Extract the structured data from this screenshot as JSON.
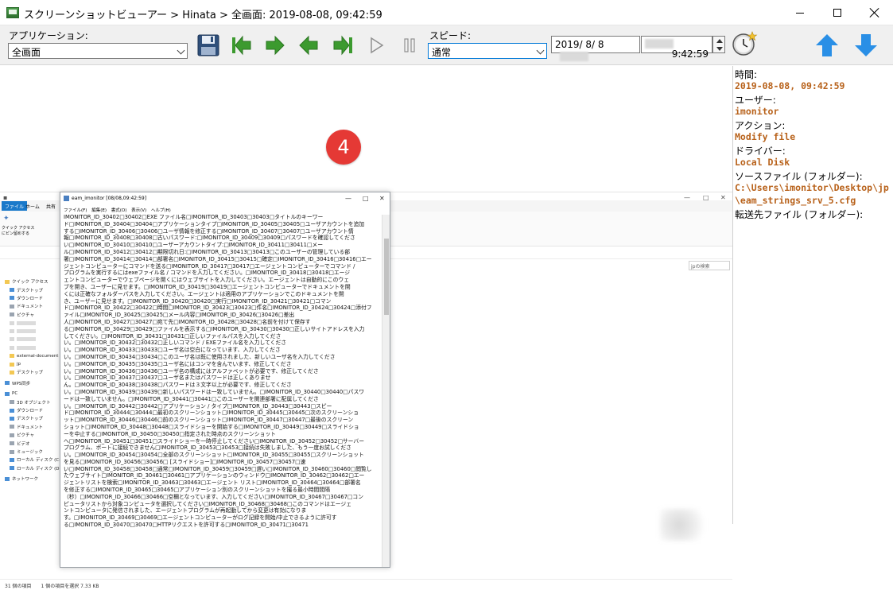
{
  "window": {
    "title": "スクリーンショットビューアー > Hinata > 全画面: 2019-08-08, 09:42:59"
  },
  "toolbar": {
    "application_label": "アプリケーション:",
    "application_value": "全画面",
    "speed_label": "スピード:",
    "speed_value": "通常",
    "date_value": "2019/ 8/ 8",
    "time_value": "9:42:59"
  },
  "badge": {
    "number": "4"
  },
  "colors": {
    "value_orange": "#b8621b",
    "nav_green": "#3c9a2f",
    "blue_arrow": "#2a8fe6",
    "badge_red": "#e53935"
  },
  "explorer": {
    "ribbon_tabs": [
      "ファイル",
      "ホーム",
      "共有"
    ],
    "ribbon_small": [
      "クイック アクセス",
      "にピン留めする"
    ],
    "search_placeholder": "jpの検索",
    "nav_items": [
      {
        "label": "クイック アクセス",
        "icon": "star-icon",
        "group": true
      },
      {
        "label": "デスクトップ",
        "icon": "desktop-icon"
      },
      {
        "label": "ダウンロード",
        "icon": "download-icon"
      },
      {
        "label": "ドキュメント",
        "icon": "document-icon"
      },
      {
        "label": "ピクチャ",
        "icon": "picture-icon"
      },
      {
        "label": "",
        "icon": "folder-icon",
        "blurred": true
      },
      {
        "label": "",
        "icon": "folder-icon",
        "blurred": true
      },
      {
        "label": "",
        "icon": "folder-icon",
        "blurred": true
      },
      {
        "label": "",
        "icon": "folder-icon",
        "blurred": true
      },
      {
        "label": "external-document",
        "icon": "folder-icon"
      },
      {
        "label": "jp",
        "icon": "folder-icon"
      },
      {
        "label": "デスクトップ",
        "icon": "folder-icon"
      },
      {
        "label": "WPS同步",
        "icon": "cloud-icon",
        "group": true
      },
      {
        "label": "PC",
        "icon": "pc-icon",
        "group": true
      },
      {
        "label": "3D オブジェクト",
        "icon": "cube-icon"
      },
      {
        "label": "ダウンロード",
        "icon": "download-icon"
      },
      {
        "label": "デスクトップ",
        "icon": "desktop-icon"
      },
      {
        "label": "ドキュメント",
        "icon": "document-icon"
      },
      {
        "label": "ピクチャ",
        "icon": "picture-icon"
      },
      {
        "label": "ビデオ",
        "icon": "video-icon"
      },
      {
        "label": "ミュージック",
        "icon": "music-icon"
      },
      {
        "label": "ローカル ディスク (C:)",
        "icon": "drive-icon"
      },
      {
        "label": "ローカル ディスク (D:)",
        "icon": "drive-icon"
      },
      {
        "label": "ネットワーク",
        "icon": "network-icon",
        "group": true
      }
    ],
    "status": "31 個の項目　　1 個の項目を選択 7.33 KB"
  },
  "notepad": {
    "title": "eam_imonitor [08/08,09:42:59]",
    "menu": "ファイル(F) 編集(E) 書式(O) 表示(V) ヘルプ(H)",
    "lines": [
      "IMONITOR_ID_30402□30402□EXE ファイル名□IMONITOR_ID_30403□30403□タイトルのキーワー",
      "ド□IMONITOR_ID_30404□30404□アプリケーションタイプ□IMONITOR_ID_30405□30405□ユーザアカウントを追加",
      "する□IMONITOR_ID_30406□30406□ユーザ情報を修正する□IMONITOR_ID_30407□30407□ユーザアカウント情",
      "報□IMONITOR_ID_30408□30408□古いパスワード:□IMONITOR_ID_30409□30409□パスワードを確認してくださ",
      "い□IMONITOR_ID_30410□30410□ユーザーアカウントタイプ:□IMONITOR_ID_30411□30411□メー",
      "ル□IMONITOR_ID_30412□30412□期限切れ日:□IMONITOR_ID_30413□30413□このユーザーの管理している部",
      "署□IMONITOR_ID_30414□30414□部署名□IMONITOR_ID_30415□30415□確定□IMONITOR_ID_30416□30416□エー",
      "ジェントコンピューターにコマンドを送る□IMONITOR_ID_30417□30417□エージェントコンピューターでコマンド /",
      "プログラムを実行するにはexeファイル名 / コマンドを入力してください。□IMONITOR_ID_30418□30418□エージ",
      "ェントコンピューターでウェブページを開くにはウェブサイトを入力してください。エージェントは自動的にこのウェ",
      "ブを開き、ユーザーに見せます。□IMONITOR_ID_30419□30419□エージェントコンピューターでドキュメントを開",
      "くには正確なフォルダーパスを入力してください。エージェントは適用のアプリケーションでこのドキュメントを開",
      "き、ユーザーに見せます。□IMONITOR_ID_30420□30420□実行□IMONITOR_ID_30421□30421□コマン",
      "ド□IMONITOR_ID_30422□30422□時間□IMONITOR_ID_30423□30423□件名□IMONITOR_ID_30424□30424□添付フ",
      "ァイル□IMONITOR_ID_30425□30425□メール内容□IMONITOR_ID_30426□30426□差出",
      "人□IMONITOR_ID_30427□30427□宛て先□IMONITOR_ID_30428□30428□名前を付けて保存す",
      "る□IMONITOR_ID_30429□30429□ファイルを表示する□IMONITOR_ID_30430□30430□正しいサイトアドレスを入力",
      "してください。□IMONITOR_ID_30431□30431□正しいファイルパスを入力してくださ",
      "い。□IMONITOR_ID_30432□30432□正しいコマンド / EXEファイル名を入力してくださ",
      "い。□IMONITOR_ID_30433□30433□ユーザ名は空白になっています、入力してくださ",
      "い。□IMONITOR_ID_30434□30434□このユーザ名は既に使用されました、新しいユーザ名を入力してくださ",
      "い。□IMONITOR_ID_30435□30435□ユーザ名にはコンマを含んでいます、修正してくださ",
      "い。□IMONITOR_ID_30436□30436□ユーザ名の構成にはアルファベットが必要です、修正してくださ",
      "い。□IMONITOR_ID_30437□30437□ユーザ名またはパスワードは正しくありませ",
      "ん。□IMONITOR_ID_30438□30438□パスワードは３文字以上が必要です、修正してくださ",
      "い。□IMONITOR_ID_30439□30439□新しいパスワードは一致していません。□IMONITOR_ID_30440□30440□パスワ",
      "ードは一致していません。□IMONITOR_ID_30441□30441□このユーザーを関連部署に配属してくださ",
      "い。□IMONITOR_ID_30442□30442□アプリケーション / タイプ□IMONITOR_ID_30443□30443□スピー",
      "ド□IMONITOR_ID_30444□30444□最初のスクリーンショット□IMONITOR_ID_30445□30445□次のスクリーンショ",
      "ット□IMONITOR_ID_30446□30446□前のスクリーンショット□IMONITOR_ID_30447□30447□最後のスクリーン",
      "ショット□IMONITOR_ID_30448□30448□スライドショーを開始する□IMONITOR_ID_30449□30449□スライドショ",
      "ーを中止する□IMONITOR_ID_30450□30450□指定された時点のスクリーンショット",
      "へ□IMONITOR_ID_30451□30451□スライドショーを一時停止してください□IMONITOR_ID_30452□30452□サーバー",
      "プログラム、ポートに接続できません□IMONITOR_ID_30453□30453□接続は失敗しました、もう一度お試しくださ",
      "い。□IMONITOR_ID_30454□30454□全部のスクリーンショット□IMONITOR_ID_30455□30455□スクリーンショット",
      "を見る□IMONITOR_ID_30456□30456□ [スライドショー]□IMONITOR_ID_30457□30457□速",
      "い□IMONITOR_ID_30458□30458□通常□IMONITOR_ID_30459□30459□遅い□IMONITOR_ID_30460□30460□閲覧し",
      "たウェブサイト□IMONITOR_ID_30461□30461□アプリケーションのウィンドウ□IMONITOR_ID_30462□30462□エー",
      "ジェントリストを検索□IMONITOR_ID_30463□30463□エージェント リスト□IMONITOR_ID_30464□30464□部署名",
      "を修正する□IMONITOR_ID_30465□30465□アプリケーション別のスクリーンショットを撮る最小時間間隔",
      "（秒）□IMONITOR_ID_30466□30466□空欄となっています、入力してください□IMONITOR_ID_30467□30467□コン",
      "ピュータリストから対象コンピュータを選択してください□IMONITOR_ID_30468□30468□このコマンドはエージェ",
      "ントコンピュータに発信されました、エージェントプログラムが再起動してから変更は有効になりま",
      "す。□IMONITOR_ID_30469□30469□エージェントコンピューターがログ記録を開始/中止できるように許可す",
      "る□IMONITOR_ID_30470□30470□HTTPリクエストを許可する□IMONITOR_ID_30471□30471"
    ]
  },
  "details": {
    "time_label": "時間:",
    "time_value": "2019-08-08, 09:42:59",
    "user_label": "ユーザー:",
    "user_value": "imonitor",
    "action_label": "アクション:",
    "action_value": "Modify file",
    "driver_label": "ドライバー:",
    "driver_value": "Local Disk",
    "source_label": "ソースファイル (フォルダー):",
    "source_value_line1": "C:\\Users\\imonitor\\Desktop\\jp",
    "source_value_line2": "\\eam_strings_srv_5.cfg",
    "dest_label": "転送先ファイル (フォルダー):"
  }
}
